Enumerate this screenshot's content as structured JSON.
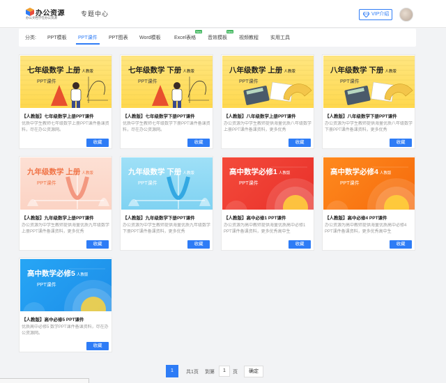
{
  "header": {
    "logo_main": "办公资源",
    "logo_sub": "办公文档学在办公资源",
    "title": "专题中心",
    "vip_label": "VIP介绍"
  },
  "categories": {
    "label": "分类:",
    "items": [
      {
        "label": "PPT模板",
        "active": false,
        "badge": ""
      },
      {
        "label": "PPT课件",
        "active": true,
        "badge": ""
      },
      {
        "label": "PPT图表",
        "active": false,
        "badge": ""
      },
      {
        "label": "Word模板",
        "active": false,
        "badge": ""
      },
      {
        "label": "Excel表格",
        "active": false,
        "badge": "New"
      },
      {
        "label": "音效模板",
        "active": false,
        "badge": "New"
      },
      {
        "label": "视频教程",
        "active": false,
        "badge": ""
      },
      {
        "label": "实用工具",
        "active": false,
        "badge": ""
      }
    ]
  },
  "cards": [
    {
      "thumb_title": "七年级数学 上册",
      "edition": "人教版",
      "thumb_sub": "PPT课件",
      "title": "【人教版】七年级数学上册PPT课件",
      "desc": "优质中学生教师七年级数学上册PPT课件备课资料，尽在办公资源网。",
      "button": "收藏",
      "theme": "yellow",
      "art": "teacher"
    },
    {
      "thumb_title": "七年级数学 下册",
      "edition": "人教版",
      "thumb_sub": "PPT课件",
      "title": "【人教版】七年级数学下册PPT课件",
      "desc": "优质中学生教师七年级数学下册PPT课件备课资料，尽在办公资源网。",
      "button": "收藏",
      "theme": "yellow",
      "art": "teacher"
    },
    {
      "thumb_title": "八年级数学 上册",
      "edition": "人教版",
      "thumb_sub": "PPT课件",
      "title": "【人教版】八年级数学上册PPT课件",
      "desc": "办公资源为中学生教师提供海量优质八年级数学上册PPT课件备课资料，更多优秀",
      "button": "收藏",
      "theme": "yellow",
      "art": "tools"
    },
    {
      "thumb_title": "八年级数学 下册",
      "edition": "人教版",
      "thumb_sub": "PPT课件",
      "title": "【人教版】八年级数学下册PPT课件",
      "desc": "办公资源为中学生教师提供海量优质八年级数学下册PPT课件备课资料，更多优秀",
      "button": "收藏",
      "theme": "yellow",
      "art": "tools"
    },
    {
      "thumb_title": "九年级数学 上册",
      "edition": "人教版",
      "thumb_sub": "PPT课件",
      "title": "【人教版】九年级数学上册PPT课件",
      "desc": "办公资源为中学生教师提供海量优质九年级数学上册PPT课件备课资料，更多优秀",
      "button": "收藏",
      "theme": "peach",
      "art": "parabola"
    },
    {
      "thumb_title": "九年级数学 下册",
      "edition": "人教版",
      "thumb_sub": "PPT课件",
      "title": "【人教版】九年级数学下册PPT课件",
      "desc": "办公资源为中学生教师提供海量优质九年级数学下册PPT课件备课资料，更多优秀",
      "button": "收藏",
      "theme": "sky",
      "art": "parabola"
    },
    {
      "thumb_title": "高中数学必修1",
      "edition": "人教版",
      "thumb_sub": "PPT课件",
      "title": "【人教版】高中必修1 PPT课件",
      "desc": "办公资源为高中教师提供海量优质高中必修1 PPT课件备课资料，更多优秀高中生",
      "button": "收藏",
      "theme": "red",
      "art": "circles"
    },
    {
      "thumb_title": "高中数学必修4",
      "edition": "人教版",
      "thumb_sub": "PPT课件",
      "title": "【人教版】高中必修4 PPT课件",
      "desc": "办公资源为高中教师提供海量优质高中必修4 PPT课件备课资料，更多优秀高中生",
      "button": "收藏",
      "theme": "orange",
      "art": "circles"
    },
    {
      "thumb_title": "高中数学必修5",
      "edition": "人教版",
      "thumb_sub": "PPT课件",
      "title": "【人教版】高中必修5 PPT课件",
      "desc": "优质高中必修5 数学PPT课件备课资料，尽在办公资源网。",
      "button": "收藏",
      "theme": "blue",
      "art": "circles"
    }
  ],
  "pagination": {
    "current": "1",
    "total_text": "共1页",
    "goto_label": "到第",
    "goto_value": "1",
    "page_unit": "页",
    "confirm": "确定"
  }
}
